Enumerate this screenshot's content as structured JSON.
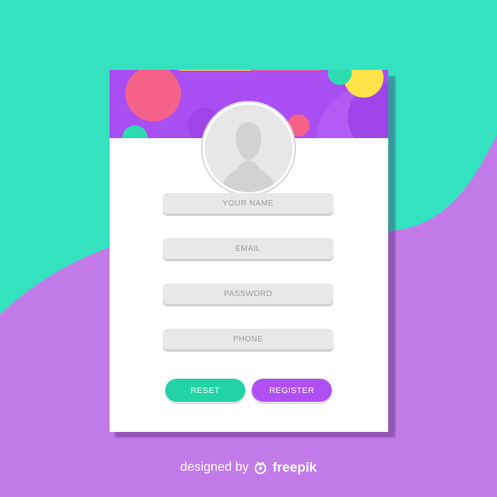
{
  "colors": {
    "teal": "#34e2c0",
    "purple": "#c37ae9",
    "header_purple": "#a94ef2",
    "pink": "#f4628a",
    "yellow": "#ffe24a",
    "green_button": "#22d3a6",
    "purple_button": "#b150f2"
  },
  "form": {
    "name_placeholder": "YOUR NAME",
    "email_placeholder": "EMAIL",
    "password_placeholder": "PASSWORD",
    "phone_placeholder": "PHONE"
  },
  "buttons": {
    "reset_label": "RESET",
    "register_label": "REGISTER"
  },
  "avatar": {
    "icon": "user-silhouette-icon"
  },
  "footer": {
    "designed_by": "designed by",
    "brand": "freepik",
    "logo_icon": "freepik-logo-icon"
  }
}
